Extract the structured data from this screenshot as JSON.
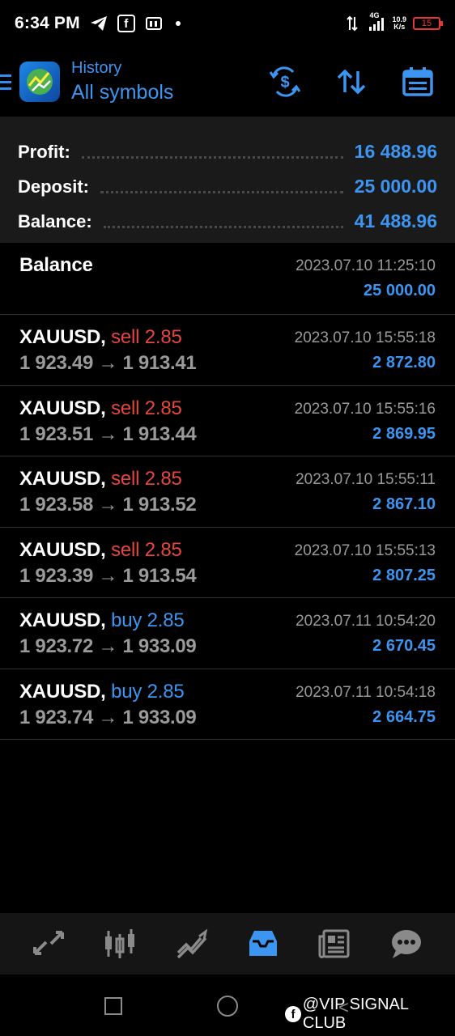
{
  "status_bar": {
    "time": "6:34 PM",
    "network_type": "4G",
    "speed": "10.9",
    "speed_unit": "K/s",
    "battery": "15"
  },
  "header": {
    "subtitle": "History",
    "title": "All symbols"
  },
  "summary": {
    "profit_label": "Profit:",
    "profit_value": "16 488.96",
    "deposit_label": "Deposit:",
    "deposit_value": "25 000.00",
    "balance_label": "Balance:",
    "balance_value": "41 488.96"
  },
  "balance_entry": {
    "label": "Balance",
    "time": "2023.07.10 11:25:10",
    "amount": "25 000.00"
  },
  "trades": [
    {
      "symbol": "XAUUSD,",
      "action": "sell 2.85",
      "type": "sell",
      "prices": "1 923.49 → 1 913.41",
      "time": "2023.07.10 15:55:18",
      "profit": "2 872.80"
    },
    {
      "symbol": "XAUUSD,",
      "action": "sell 2.85",
      "type": "sell",
      "prices": "1 923.51 → 1 913.44",
      "time": "2023.07.10 15:55:16",
      "profit": "2 869.95"
    },
    {
      "symbol": "XAUUSD,",
      "action": "sell 2.85",
      "type": "sell",
      "prices": "1 923.58 → 1 913.52",
      "time": "2023.07.10 15:55:11",
      "profit": "2 867.10"
    },
    {
      "symbol": "XAUUSD,",
      "action": "sell 2.85",
      "type": "sell",
      "prices": "1 923.39 → 1 913.54",
      "time": "2023.07.10 15:55:13",
      "profit": "2 807.25"
    },
    {
      "symbol": "XAUUSD,",
      "action": "buy 2.85",
      "type": "buy",
      "prices": "1 923.72 → 1 933.09",
      "time": "2023.07.11 10:54:20",
      "profit": "2 670.45"
    },
    {
      "symbol": "XAUUSD,",
      "action": "buy 2.85",
      "type": "buy",
      "prices": "1 923.74 → 1 933.09",
      "time": "2023.07.11 10:54:18",
      "profit": "2 664.75"
    }
  ],
  "bottom_nav": {
    "items": [
      {
        "icon": "quotes-icon",
        "active": false
      },
      {
        "icon": "chart-icon",
        "active": false
      },
      {
        "icon": "trade-icon",
        "active": false
      },
      {
        "icon": "history-icon",
        "active": true
      },
      {
        "icon": "news-icon",
        "active": false
      },
      {
        "icon": "chat-icon",
        "active": false
      }
    ]
  },
  "watermark": {
    "text": "@VIP SIGNAL CLUB"
  },
  "colors": {
    "accent": "#3d95f2",
    "sell": "#e5463d",
    "muted": "#9a9a9a"
  }
}
